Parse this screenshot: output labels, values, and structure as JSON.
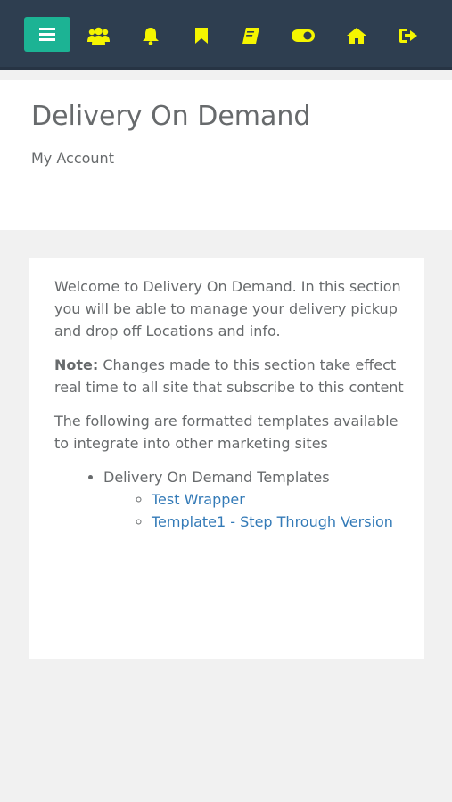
{
  "topbar": {
    "icons": [
      {
        "name": "menu-icon"
      },
      {
        "name": "users-icon"
      },
      {
        "name": "bell-icon"
      },
      {
        "name": "bookmark-icon"
      },
      {
        "name": "book-icon"
      },
      {
        "name": "toggle-icon"
      },
      {
        "name": "home-icon"
      },
      {
        "name": "sign-out-icon"
      }
    ],
    "accent_color": "#1cb394",
    "icon_color": "#f5f500",
    "bar_color": "#2e3e50"
  },
  "header": {
    "title": "Delivery On Demand",
    "breadcrumb": "My Account"
  },
  "content": {
    "intro": "Welcome to Delivery On Demand. In this section you will be able to manage your delivery pickup and drop off Locations and info.",
    "note_label": "Note:",
    "note_text": " Changes made to this section take effect real time to all site that subscribe to this content",
    "templates_intro": "The following are formatted templates available to integrate into other marketing sites",
    "list": {
      "heading": "Delivery On Demand Templates",
      "links": [
        "Test Wrapper",
        "Template1 - Step Through Version"
      ]
    }
  }
}
